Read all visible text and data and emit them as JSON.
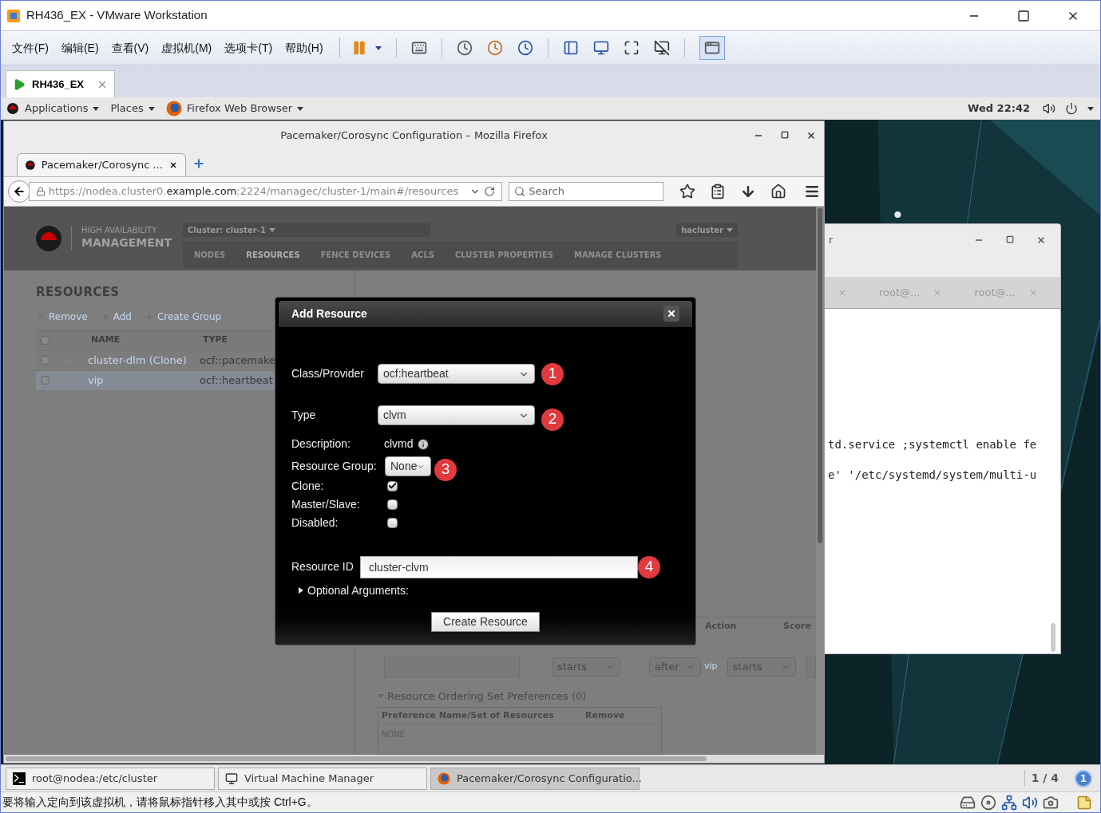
{
  "vmware": {
    "title": "RH436_EX - VMware Workstation",
    "menu": [
      "文件(F)",
      "编辑(E)",
      "查看(V)",
      "虚拟机(M)",
      "选项卡(T)",
      "帮助(H)"
    ],
    "tab": "RH436_EX"
  },
  "gnome_panel": {
    "menus": [
      "Applications",
      "Places",
      "Firefox Web Browser"
    ],
    "clock": "Wed 22:42"
  },
  "firefox": {
    "title": "Pacemaker/Corosync Configuration – Mozilla Firefox",
    "tab": "Pacemaker/Corosync ...",
    "url": {
      "host": "https://nodea.cluster0.",
      "domain": "example.com",
      "path": ":2224/managec/cluster-1/main#/resources"
    },
    "search_placeholder": "Search"
  },
  "ha_app": {
    "brand_top": "HIGH AVAILABILITY",
    "brand_bottom": "MANAGEMENT",
    "cluster_menu": "Cluster: cluster-1",
    "user_menu": "hacluster",
    "nav": [
      {
        "label": "NODES",
        "selected": false
      },
      {
        "label": "RESOURCES",
        "selected": true
      },
      {
        "label": "FENCE DEVICES",
        "selected": false
      },
      {
        "label": "ACLS",
        "selected": false
      },
      {
        "label": "CLUSTER PROPERTIES",
        "selected": false
      },
      {
        "label": "MANAGE CLUSTERS",
        "selected": false
      }
    ]
  },
  "resources": {
    "heading": "RESOURCES",
    "actions": [
      {
        "label": "Remove",
        "kind": "remove"
      },
      {
        "label": "Add",
        "kind": "add"
      },
      {
        "label": "Create Group",
        "kind": "add"
      }
    ],
    "columns": [
      "NAME",
      "TYPE"
    ],
    "all_checked": false,
    "rows": [
      {
        "name": "cluster-dlm (Clone)",
        "type": "ocf::pacemake",
        "checked": false,
        "selected": false
      },
      {
        "name": "vip",
        "type": "ocf::heartbeat",
        "checked": false,
        "selected": true
      }
    ]
  },
  "constraints": {
    "columns": [
      "Action",
      "Score"
    ],
    "selects": [
      "starts",
      "after",
      "starts"
    ],
    "link": "vip",
    "ordering_set": {
      "title": "Resource Ordering Set Preferences (0)",
      "expanded": true,
      "columns": [
        "Preference Name/Set of Resources",
        "Remove"
      ],
      "empty": "NONE"
    }
  },
  "dialog": {
    "title": "Add Resource",
    "class_provider": {
      "label": "Class/Provider",
      "value": "ocf:heartbeat",
      "badge": "1"
    },
    "type": {
      "label": "Type",
      "value": "clvm",
      "badge": "2"
    },
    "description": {
      "label": "Description:",
      "value": "clvmd"
    },
    "resource_group": {
      "label": "Resource Group:",
      "value": "None",
      "badge": "3"
    },
    "checkboxes": [
      {
        "label": "Clone:",
        "checked": true
      },
      {
        "label": "Master/Slave:",
        "checked": false
      },
      {
        "label": "Disabled:",
        "checked": false
      }
    ],
    "resource_id": {
      "label": "Resource ID",
      "value": "cluster-clvm",
      "badge": "4"
    },
    "optional_arguments": {
      "label": "Optional Arguments:",
      "expanded": false
    },
    "button": "Create Resource"
  },
  "terminal": {
    "title": "r",
    "tabs": [
      "root@...",
      "root@..."
    ],
    "lines": [
      "td.service ;systemctl enable fe",
      "e' '/etc/systemd/system/multi-u"
    ]
  },
  "taskbar": {
    "items": [
      {
        "label": "root@nodea:/etc/cluster",
        "kind": "terminal",
        "selected": false
      },
      {
        "label": "Virtual Machine Manager",
        "kind": "vmm",
        "selected": false
      },
      {
        "label": "Pacemaker/Corosync Configuratio...",
        "kind": "firefox",
        "selected": true
      }
    ],
    "workspace": "1 / 4",
    "notifications": "1"
  },
  "status_bar": {
    "message": "要将输入定向到该虚拟机，请将鼠标指针移入其中或按 Ctrl+G。"
  }
}
